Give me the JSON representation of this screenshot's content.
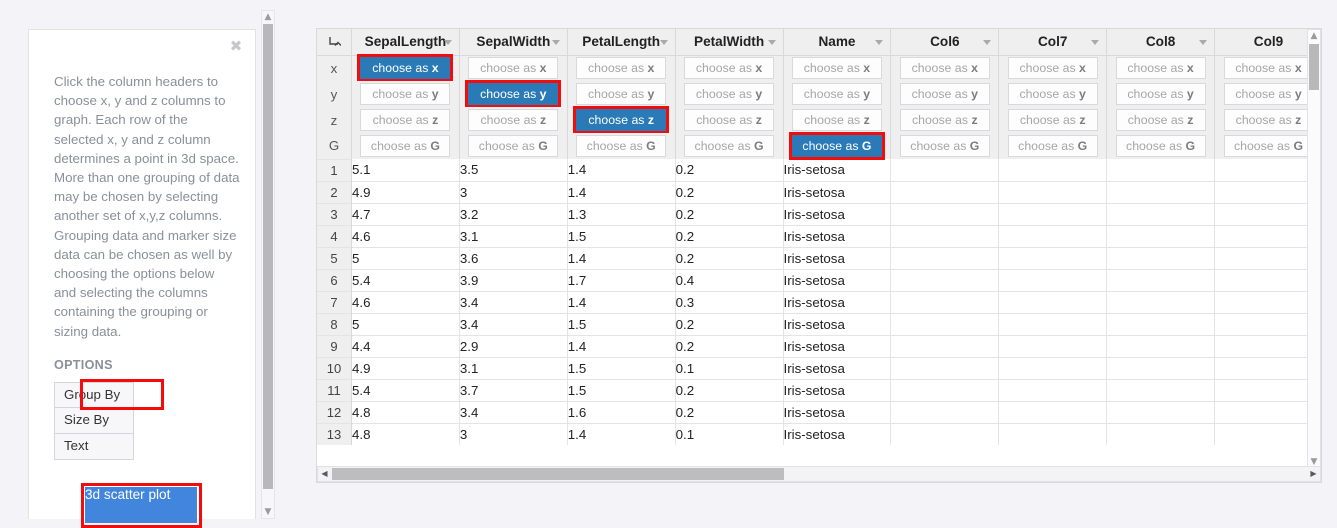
{
  "left_panel": {
    "close_icon": "✖",
    "intro_text": "Click the column headers to choose x, y and z columns to graph. Each row of the selected x, y and z column determines a point in 3d space. More than one grouping of data may be chosen by selecting another set of x,y,z columns. Grouping data and marker size data can be chosen as well by choosing the options below and selecting the columns containing the grouping or sizing data.",
    "options_label": "OPTIONS",
    "options": [
      {
        "label": "Group By",
        "highlighted": true
      },
      {
        "label": "Size By",
        "highlighted": false
      },
      {
        "label": "Text",
        "highlighted": false
      }
    ],
    "plot_button": {
      "label": "3d scatter plot",
      "highlighted": true,
      "color": "#4285dd"
    }
  },
  "table": {
    "corner_icon": "turn-arrow-icon",
    "axis_rows": [
      "x",
      "y",
      "z",
      "G"
    ],
    "chooser_prefix": "choose as ",
    "selected_color": "#2a7ab8",
    "annotation_color": "#f40c0c",
    "columns": [
      {
        "name": "SepalLength",
        "assigned": "x"
      },
      {
        "name": "SepalWidth",
        "assigned": "y"
      },
      {
        "name": "PetalLength",
        "assigned": "z"
      },
      {
        "name": "PetalWidth",
        "assigned": null
      },
      {
        "name": "Name",
        "assigned": "G"
      },
      {
        "name": "Col6",
        "assigned": null
      },
      {
        "name": "Col7",
        "assigned": null
      },
      {
        "name": "Col8",
        "assigned": null
      },
      {
        "name": "Col9",
        "assigned": null
      }
    ],
    "rows": [
      {
        "n": "1",
        "cells": [
          "5.1",
          "3.5",
          "1.4",
          "0.2",
          "Iris-setosa",
          "",
          "",
          "",
          ""
        ]
      },
      {
        "n": "2",
        "cells": [
          "4.9",
          "3",
          "1.4",
          "0.2",
          "Iris-setosa",
          "",
          "",
          "",
          ""
        ]
      },
      {
        "n": "3",
        "cells": [
          "4.7",
          "3.2",
          "1.3",
          "0.2",
          "Iris-setosa",
          "",
          "",
          "",
          ""
        ]
      },
      {
        "n": "4",
        "cells": [
          "4.6",
          "3.1",
          "1.5",
          "0.2",
          "Iris-setosa",
          "",
          "",
          "",
          ""
        ]
      },
      {
        "n": "5",
        "cells": [
          "5",
          "3.6",
          "1.4",
          "0.2",
          "Iris-setosa",
          "",
          "",
          "",
          ""
        ]
      },
      {
        "n": "6",
        "cells": [
          "5.4",
          "3.9",
          "1.7",
          "0.4",
          "Iris-setosa",
          "",
          "",
          "",
          ""
        ]
      },
      {
        "n": "7",
        "cells": [
          "4.6",
          "3.4",
          "1.4",
          "0.3",
          "Iris-setosa",
          "",
          "",
          "",
          ""
        ]
      },
      {
        "n": "8",
        "cells": [
          "5",
          "3.4",
          "1.5",
          "0.2",
          "Iris-setosa",
          "",
          "",
          "",
          ""
        ]
      },
      {
        "n": "9",
        "cells": [
          "4.4",
          "2.9",
          "1.4",
          "0.2",
          "Iris-setosa",
          "",
          "",
          "",
          ""
        ]
      },
      {
        "n": "10",
        "cells": [
          "4.9",
          "3.1",
          "1.5",
          "0.1",
          "Iris-setosa",
          "",
          "",
          "",
          ""
        ]
      },
      {
        "n": "11",
        "cells": [
          "5.4",
          "3.7",
          "1.5",
          "0.2",
          "Iris-setosa",
          "",
          "",
          "",
          ""
        ]
      },
      {
        "n": "12",
        "cells": [
          "4.8",
          "3.4",
          "1.6",
          "0.2",
          "Iris-setosa",
          "",
          "",
          "",
          ""
        ]
      },
      {
        "n": "13",
        "cells": [
          "4.8",
          "3",
          "1.4",
          "0.1",
          "Iris-setosa",
          "",
          "",
          "",
          ""
        ]
      }
    ]
  },
  "scrollbars": {
    "up_arrow": "▲",
    "down_arrow": "▼",
    "left_arrow": "◀",
    "right_arrow": "▶"
  }
}
